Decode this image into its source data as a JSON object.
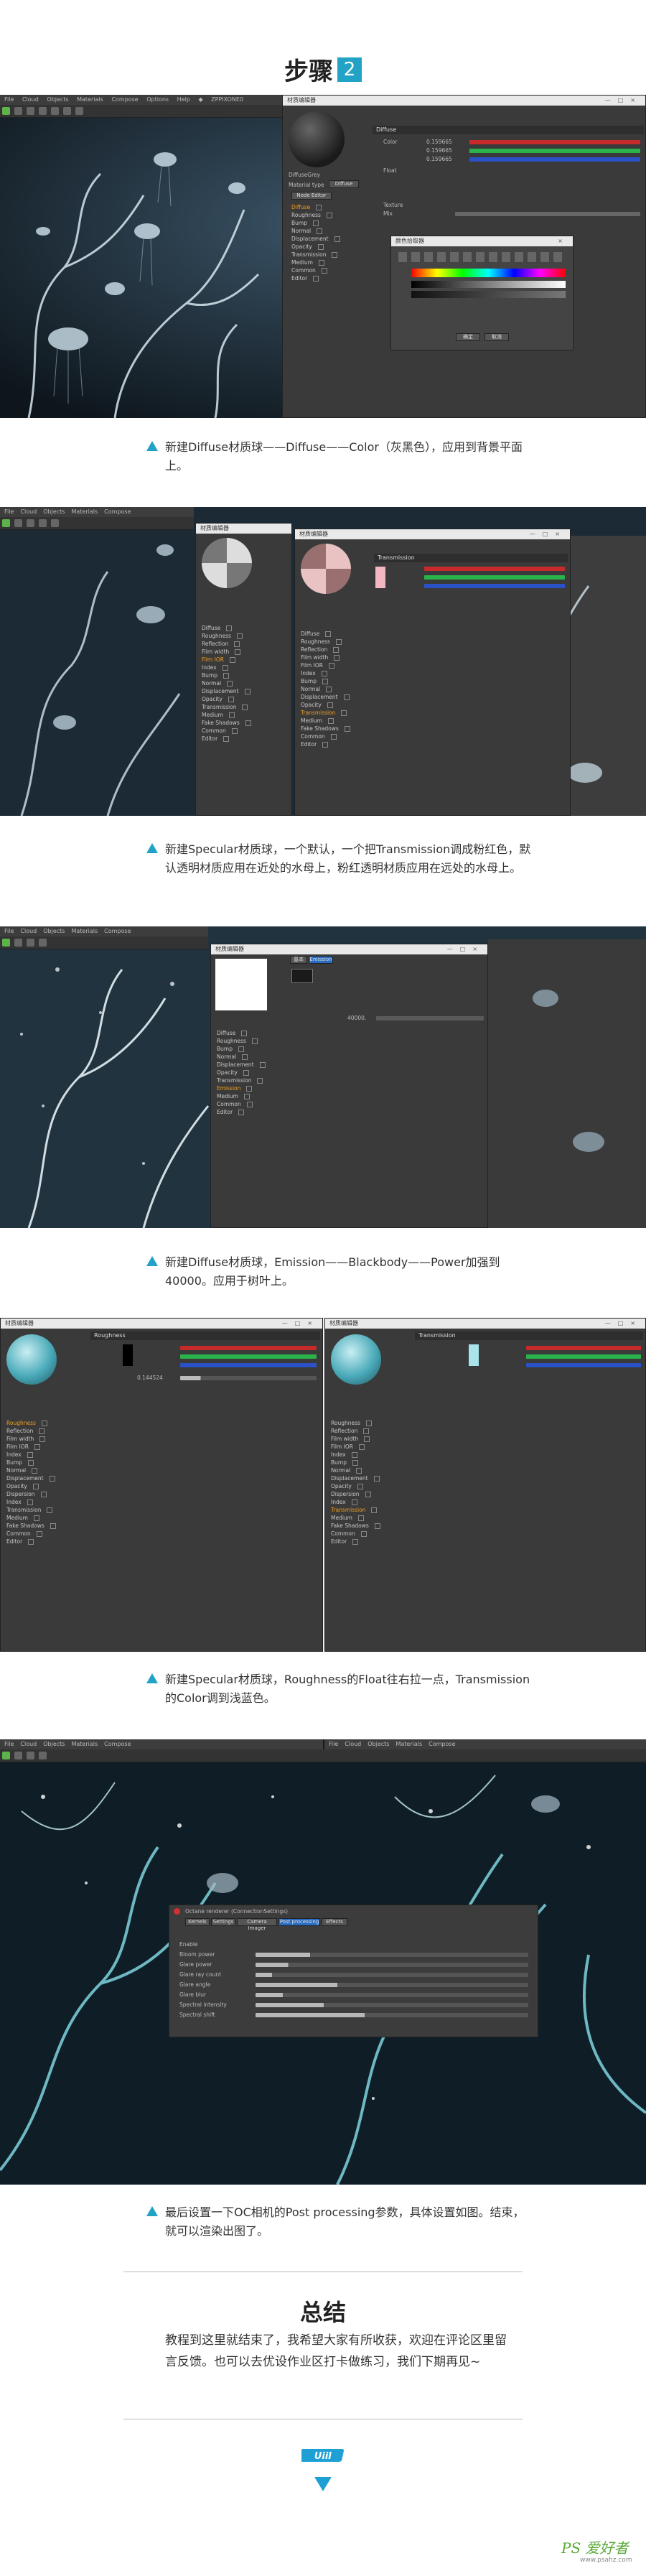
{
  "step": {
    "label": "步骤",
    "number": "2"
  },
  "app": {
    "menu": [
      "File",
      "Cloud",
      "Objects",
      "Materials",
      "Compose",
      "Options",
      "Help",
      "◆",
      "ZPPIXONE0"
    ],
    "menu2": [
      "File",
      "Cloud",
      "Objects",
      "Materials",
      "Compose",
      "Options",
      "Help"
    ],
    "window_title": "材质编辑器",
    "color_picker_title": "颜色拾取器"
  },
  "shots": {
    "s1": {
      "section": "Diffuse",
      "param_color": "Color",
      "param_float": "Float",
      "param_texture": "Texture",
      "param_mix": "Mix",
      "rgb_values": [
        "0.159665",
        "0.159665",
        "0.159665"
      ],
      "material_name": "DiffuseGrey",
      "material_type_label": "Material type",
      "material_type_value": "Diffuse",
      "node_editor": "Node Editor",
      "channels": [
        "Diffuse",
        "Roughness",
        "Bump",
        "Normal",
        "Displacement",
        "Opacity",
        "Transmission",
        "Medium",
        "Common",
        "Editor"
      ],
      "picker_buttons": [
        "确定",
        "取消"
      ]
    },
    "s2": {
      "title_left": "材质编辑器",
      "title_right": "材质编辑器",
      "section": "Transmission",
      "channels": [
        "Diffuse",
        "Roughness",
        "Reflection",
        "Film width",
        "Film IOR",
        "Index",
        "Bump",
        "Normal",
        "Displacement",
        "Opacity",
        "Transmission",
        "Medium",
        "Fake Shadows",
        "Common",
        "Editor"
      ]
    },
    "s3": {
      "tabs": [
        "基本",
        "Emission"
      ],
      "channels": [
        "Diffuse",
        "Roughness",
        "Bump",
        "Normal",
        "Displacement",
        "Opacity",
        "Transmission",
        "Emission",
        "Medium",
        "Common",
        "Editor"
      ],
      "power_value": "40000."
    },
    "s4": {
      "section_left": "Roughness",
      "section_right": "Transmission",
      "float_value": "0.144524",
      "channels": [
        "Roughness",
        "Reflection",
        "Film width",
        "Film IOR",
        "Index",
        "Bump",
        "Normal",
        "Displacement",
        "Opacity",
        "Dispersion",
        "Index",
        "Transmission",
        "Medium",
        "Fake Shadows",
        "Common",
        "Editor"
      ]
    },
    "s5": {
      "dialog_title": "Octane renderer (ConnectionSettings)",
      "tabs": [
        "Kernels",
        "Settings",
        "Camera Imager",
        "Post processing",
        "Effects"
      ],
      "rows": [
        "Enable",
        "Bloom power",
        "Glare power",
        "Glare ray count",
        "Glare angle",
        "Glare blur",
        "Spectral intensity",
        "Spectral shift"
      ]
    }
  },
  "captions": [
    "新建Diffuse材质球——Diffuse——Color（灰黑色），应用到背景平面上。",
    "新建Specular材质球，一个默认，一个把Transmission调成粉红色，默认透明材质应用在近处的水母上，粉红透明材质应用在远处的水母上。",
    "新建Diffuse材质球，Emission——Blackbody——Power加强到40000。应用于树叶上。",
    "新建Specular材质球，Roughness的Float往右拉一点，Transmission的Color调到浅蓝色。",
    "最后设置一下OC相机的Post processing参数，具体设置如图。结束，就可以渲染出图了。"
  ],
  "summary": {
    "title": "总结",
    "text": "教程到这里就结束了，我希望大家有所收获，欢迎在评论区里留言反馈。也可以去优设作业区打卡做练习，我们下期再见~"
  },
  "footer": {
    "logo": "UiiI",
    "watermark": "PS 爱好者",
    "watermark_url": "www.psahz.com"
  },
  "colors": {
    "accent": "#22a3c6",
    "ui_dark": "#3a3a3a",
    "scene_blue": "#1b2630",
    "orange_active": "#f0a020"
  }
}
